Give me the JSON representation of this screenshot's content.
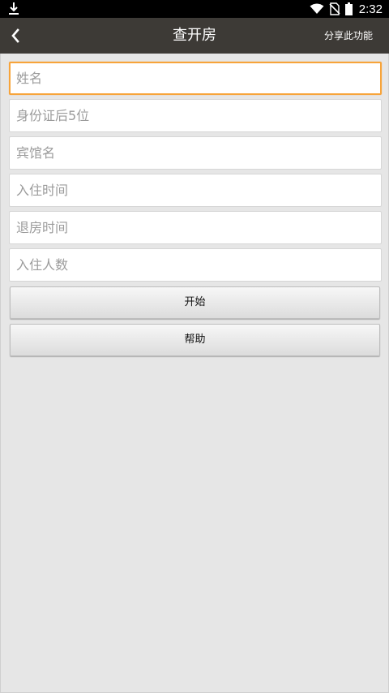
{
  "status_bar": {
    "time": "2:32",
    "icons": [
      "download-icon",
      "wifi-icon",
      "no-sim-icon",
      "battery-icon"
    ]
  },
  "header": {
    "title": "查开房",
    "share_label": "分享此功能",
    "background": "#3d3a36"
  },
  "form": {
    "fields": [
      {
        "placeholder": "姓名",
        "value": ""
      },
      {
        "placeholder": "身份证后5位",
        "value": ""
      },
      {
        "placeholder": "宾馆名",
        "value": ""
      },
      {
        "placeholder": "入住时间",
        "value": ""
      },
      {
        "placeholder": "退房时间",
        "value": ""
      },
      {
        "placeholder": "入住人数",
        "value": ""
      }
    ],
    "focus_color": "#f7a43a"
  },
  "buttons": {
    "start_label": "开始",
    "help_label": "帮助"
  }
}
